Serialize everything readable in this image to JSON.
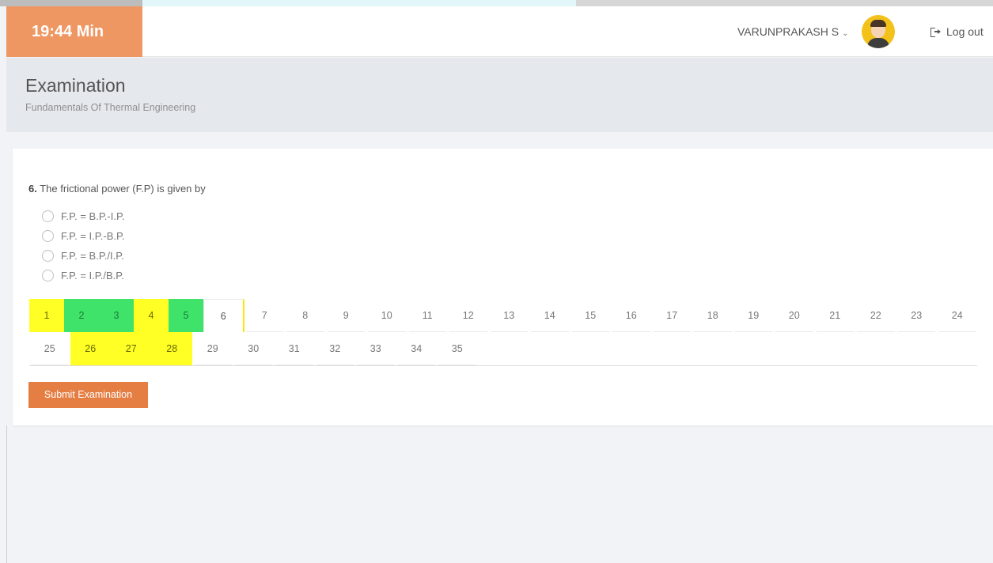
{
  "header": {
    "timer": "19:44 Min",
    "user_name": "VARUNPRAKASH S",
    "user_chevron": "⌄",
    "logout_label": "Log out",
    "colors": {
      "timer_bg": "#ef9763",
      "avatar_bg": "#f2c21b"
    }
  },
  "page": {
    "title": "Examination",
    "subtitle": "Fundamentals Of Thermal Engineering"
  },
  "question": {
    "number": "6.",
    "text": "The frictional power (F.P) is given by",
    "options": [
      {
        "label": "F.P. = B.P.-I.P.",
        "selected": false
      },
      {
        "label": "F.P. = I.P.-B.P.",
        "selected": false
      },
      {
        "label": "F.P. = B.P./I.P.",
        "selected": false
      },
      {
        "label": "F.P. = I.P./B.P.",
        "selected": false
      }
    ]
  },
  "navigator": {
    "row1": [
      {
        "num": "1",
        "state": "yellow"
      },
      {
        "num": "2",
        "state": "green"
      },
      {
        "num": "3",
        "state": "green"
      },
      {
        "num": "4",
        "state": "yellow"
      },
      {
        "num": "5",
        "state": "green"
      },
      {
        "num": "6",
        "state": "current"
      },
      {
        "num": "7",
        "state": "plain"
      },
      {
        "num": "8",
        "state": "plain"
      },
      {
        "num": "9",
        "state": "plain"
      },
      {
        "num": "10",
        "state": "plain"
      },
      {
        "num": "11",
        "state": "plain"
      },
      {
        "num": "12",
        "state": "plain"
      },
      {
        "num": "13",
        "state": "plain"
      },
      {
        "num": "14",
        "state": "plain"
      },
      {
        "num": "15",
        "state": "plain"
      },
      {
        "num": "16",
        "state": "plain"
      },
      {
        "num": "17",
        "state": "plain"
      },
      {
        "num": "18",
        "state": "plain"
      },
      {
        "num": "19",
        "state": "plain"
      },
      {
        "num": "20",
        "state": "plain"
      },
      {
        "num": "21",
        "state": "plain"
      },
      {
        "num": "22",
        "state": "plain"
      },
      {
        "num": "23",
        "state": "plain"
      },
      {
        "num": "24",
        "state": "plain"
      }
    ],
    "row2": [
      {
        "num": "25",
        "state": "plain"
      },
      {
        "num": "26",
        "state": "yellow"
      },
      {
        "num": "27",
        "state": "yellow"
      },
      {
        "num": "28",
        "state": "yellow"
      },
      {
        "num": "29",
        "state": "plain"
      },
      {
        "num": "30",
        "state": "plain"
      },
      {
        "num": "31",
        "state": "plain"
      },
      {
        "num": "32",
        "state": "plain"
      },
      {
        "num": "33",
        "state": "plain"
      },
      {
        "num": "34",
        "state": "plain"
      },
      {
        "num": "35",
        "state": "plain"
      }
    ],
    "colors": {
      "yellow": "#ffff26",
      "green": "#3fe36a"
    }
  },
  "actions": {
    "submit_label": "Submit Examination",
    "submit_color": "#e57e43"
  }
}
